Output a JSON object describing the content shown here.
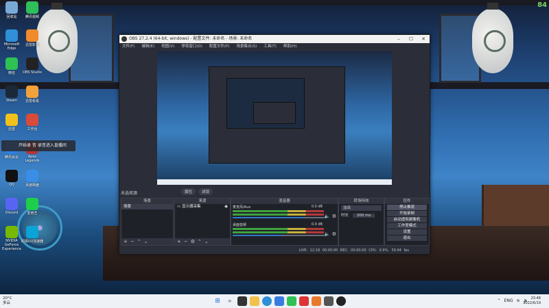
{
  "corner_number": "84",
  "desktop_icons": [
    {
      "label": "回收站",
      "color": "#7aa9d6"
    },
    {
      "label": "腾讯视频",
      "color": "#2fbf5a"
    },
    {
      "label": "Microsoft Edge",
      "color": "#2f8fd8"
    },
    {
      "label": "迅雷影音",
      "color": "#f08a2a"
    },
    {
      "label": "微信",
      "color": "#2ec254"
    },
    {
      "label": "OBS Studio",
      "color": "#222"
    },
    {
      "label": "Steam",
      "color": "#1b2838"
    },
    {
      "label": "迅雷看看",
      "color": "#f2a23a"
    },
    {
      "label": "迅雷",
      "color": "#f1c21b"
    },
    {
      "label": "工作台",
      "color": "#d84a3a"
    },
    {
      "label": "腾讯会议",
      "color": "#2f7fe0"
    },
    {
      "label": "Apex Legends",
      "color": "#b33"
    },
    {
      "label": "QQ",
      "color": "#111"
    },
    {
      "label": "百度网盘",
      "color": "#3a8ee6"
    },
    {
      "label": "Discord",
      "color": "#5865f2"
    },
    {
      "label": "爱奇艺",
      "color": "#1fce4a"
    },
    {
      "label": "NVIDIA GeForce Experience",
      "color": "#76b900"
    },
    {
      "label": "网易UU加速器",
      "color": "#0aa4d8"
    }
  ],
  "toast_text": "开始录 音 录音进入直播间",
  "obs": {
    "title": "OBS 27.2.4 (64-bit, windows) - 配置文件: 未命名 - 场景: 未命名",
    "menu": [
      "文件(F)",
      "编辑(E)",
      "视图(V)",
      "停靠窗口(D)",
      "配置文件(P)",
      "场景集合(S)",
      "工具(T)",
      "帮助(H)"
    ],
    "scene_label": "未选择源",
    "chips": [
      "属性",
      "滤镜"
    ],
    "docks": {
      "scenes": {
        "header": "场景",
        "items": [
          "场景"
        ]
      },
      "sources": {
        "header": "来源",
        "items": [
          "显示器采集"
        ]
      },
      "mixer": {
        "header": "混音器",
        "rows": [
          {
            "name": "麦克风/Aux",
            "db": "0.0 dB",
            "level": 0.78
          },
          {
            "name": "桌面音频",
            "db": "0.0 dB",
            "level": 0.55
          }
        ]
      },
      "transitions": {
        "header": "转场特效",
        "type": "淡出",
        "duration_label": "时长",
        "duration": "300 ms"
      },
      "controls": {
        "header": "控件",
        "buttons": [
          "停止推流",
          "开始录制",
          "启动虚拟摄像机",
          "工作室模式",
          "设置",
          "退出"
        ]
      }
    },
    "status": "LIVE: 12:18   00:00:00   REC: 00:00:00   CPU: 0.9%, 59.94 fps"
  },
  "taskbar": {
    "weather_temp": "20°C",
    "weather_desc": "多云",
    "tray_lang": "ENG",
    "time": "23:48",
    "date": "2022/6/19"
  }
}
